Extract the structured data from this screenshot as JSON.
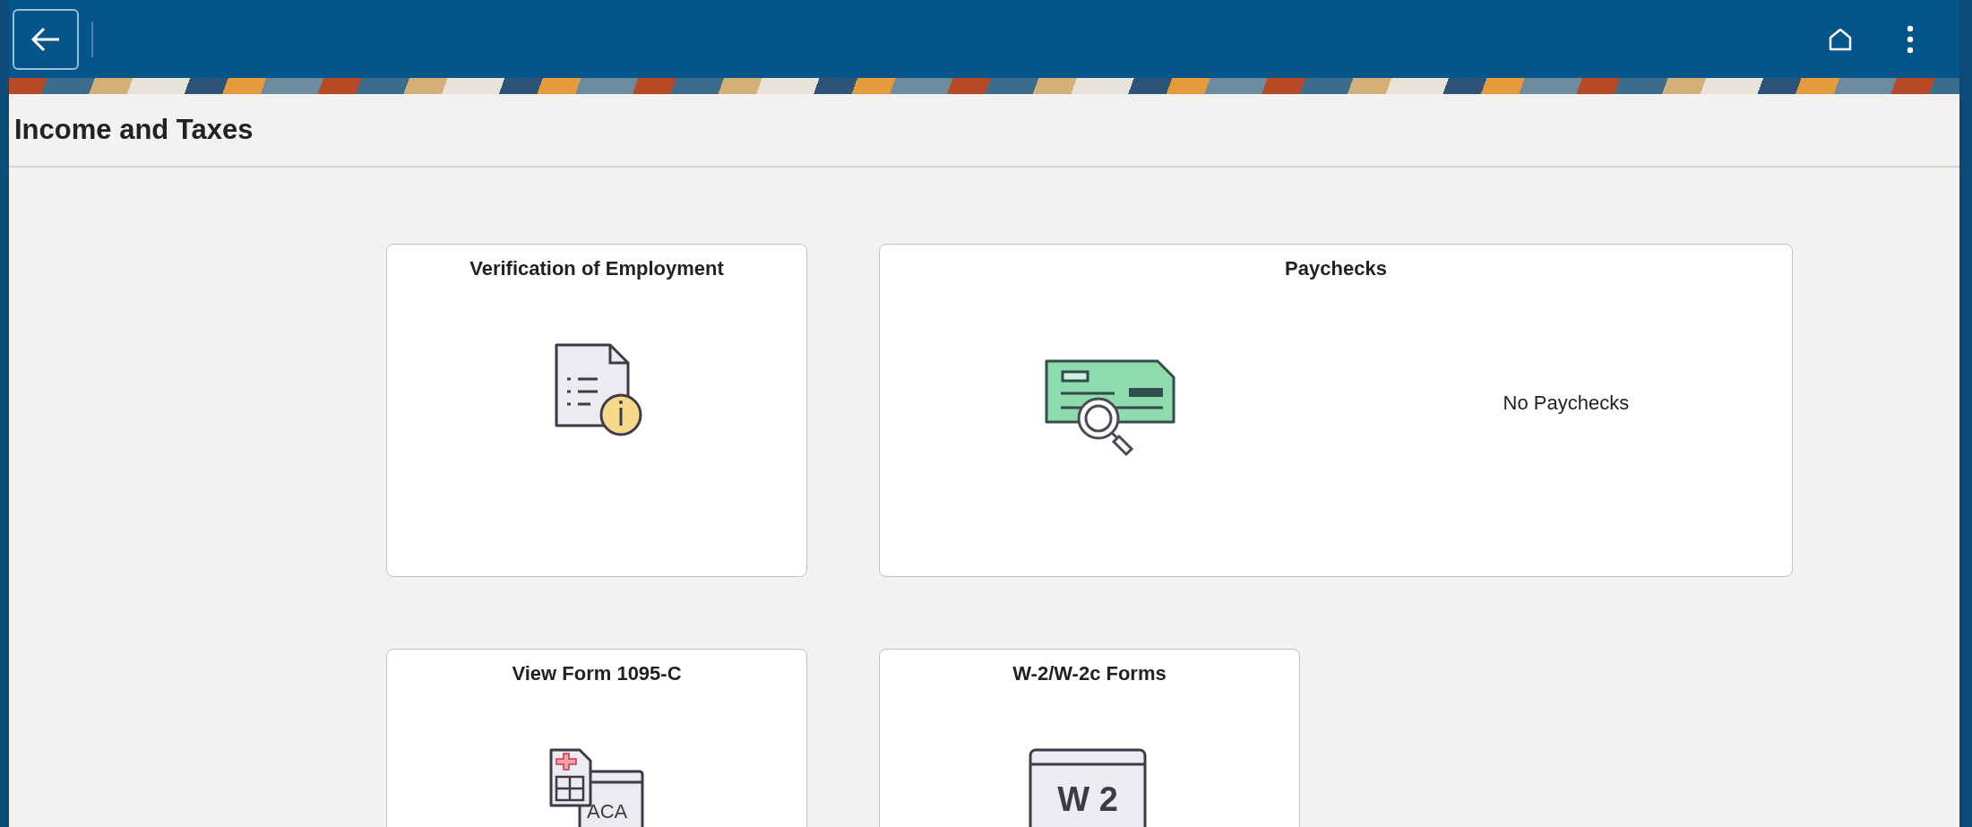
{
  "page_title": "Income and Taxes",
  "tiles": [
    {
      "title": "Verification of Employment",
      "kind": "document-info"
    },
    {
      "title": "Paychecks",
      "kind": "check-search",
      "message": "No Paychecks"
    },
    {
      "title": "View Form 1095-C",
      "kind": "aca-form",
      "icon_text": "ACA"
    },
    {
      "title": "W-2/W-2c Forms",
      "kind": "w2-form",
      "icon_text": "W 2"
    }
  ]
}
